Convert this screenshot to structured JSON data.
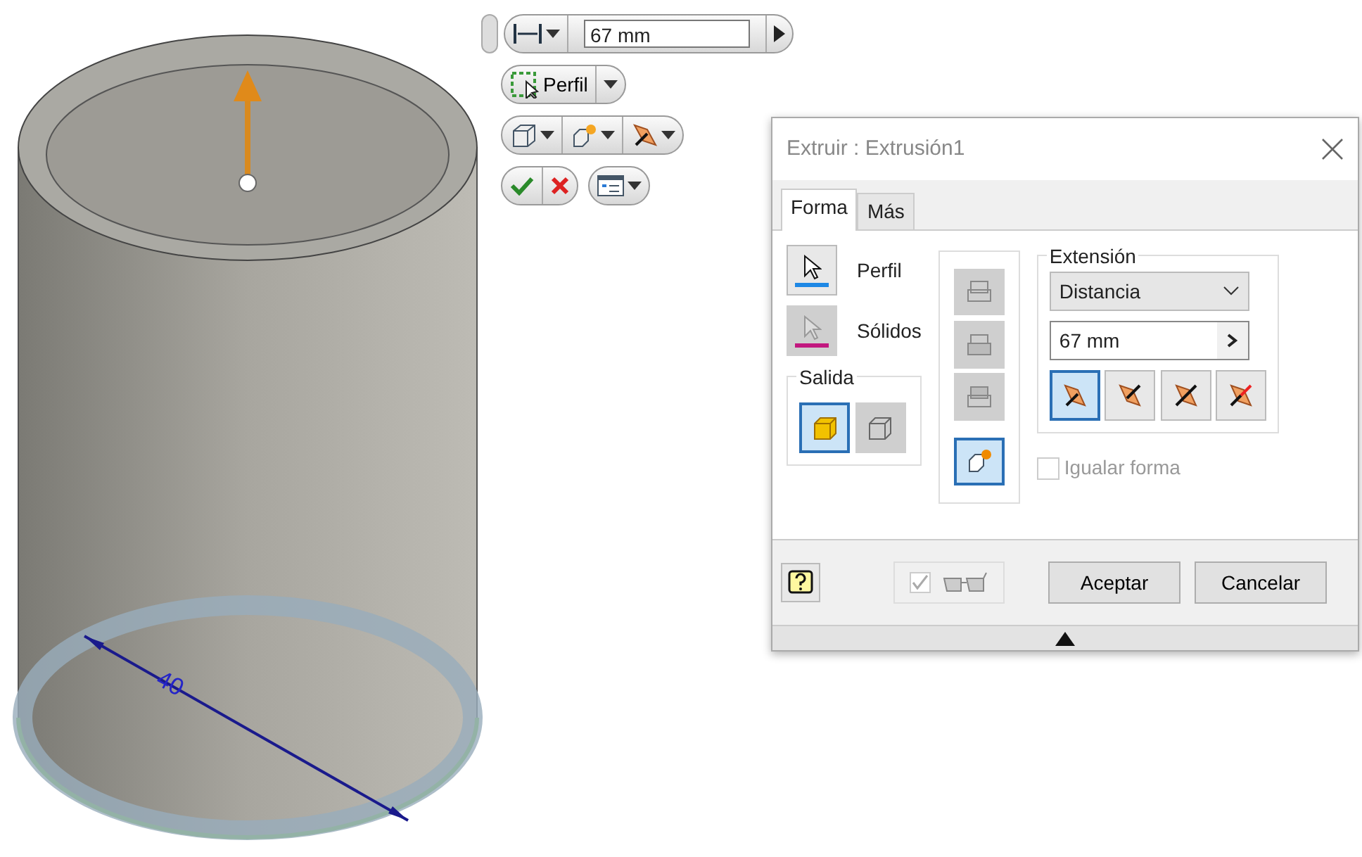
{
  "viewport": {
    "dimension_label": "40"
  },
  "mini_toolbar": {
    "distance_value": "67 mm",
    "profile_button": "Perfil"
  },
  "dialog": {
    "title": "Extruir : Extrusión1",
    "tabs": [
      {
        "label": "Forma",
        "selected": true
      },
      {
        "label": "Más",
        "selected": false
      }
    ],
    "selectors": [
      {
        "label": "Perfil",
        "selected": true,
        "color": "#1e88e5"
      },
      {
        "label": "Sólidos",
        "selected": false,
        "color": "#c2187f"
      }
    ],
    "output": {
      "title": "Salida",
      "options": [
        {
          "kind": "solid",
          "selected": true
        },
        {
          "kind": "surface",
          "selected": false
        }
      ]
    },
    "operations": [
      {
        "kind": "join",
        "selected": false
      },
      {
        "kind": "cut",
        "selected": false
      },
      {
        "kind": "intersect",
        "selected": false
      },
      {
        "kind": "new-solid",
        "selected": true
      }
    ],
    "extent": {
      "title": "Extensión",
      "method": "Distancia",
      "distance": "67 mm",
      "directions": [
        {
          "kind": "default",
          "selected": true
        },
        {
          "kind": "flipped",
          "selected": false
        },
        {
          "kind": "symmetric",
          "selected": false
        },
        {
          "kind": "asymmetric",
          "selected": false
        }
      ]
    },
    "match_shape": {
      "label": "Igualar forma",
      "checked": false
    },
    "preview": {
      "checked": true
    },
    "buttons": [
      "Aceptar",
      "Cancelar"
    ]
  }
}
